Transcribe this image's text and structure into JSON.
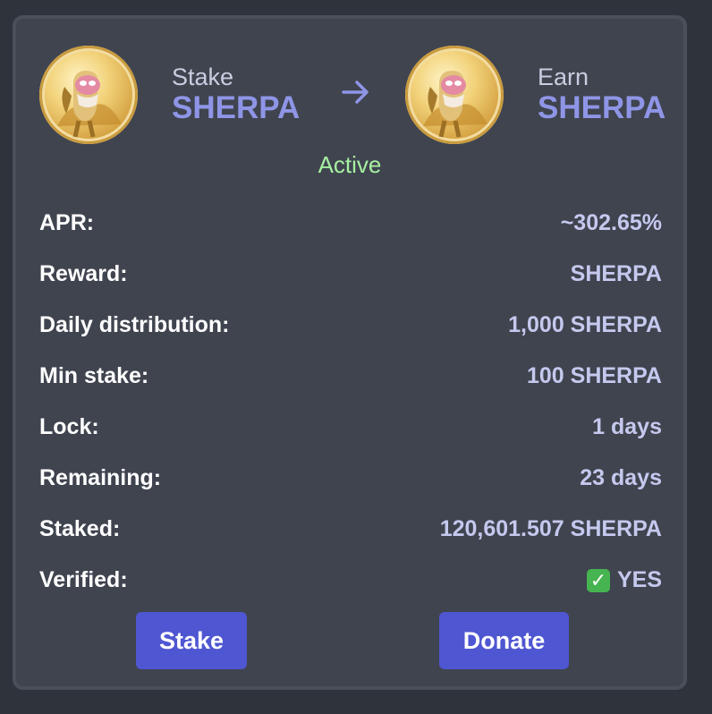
{
  "stake": {
    "verb": "Stake",
    "symbol": "SHERPA"
  },
  "earn": {
    "verb": "Earn",
    "symbol": "SHERPA"
  },
  "status": "Active",
  "rows": [
    {
      "label": "APR:",
      "value": "~302.65%"
    },
    {
      "label": "Reward:",
      "value": "SHERPA"
    },
    {
      "label": "Daily distribution:",
      "value": "1,000 SHERPA"
    },
    {
      "label": "Min stake:",
      "value": "100 SHERPA"
    },
    {
      "label": "Lock:",
      "value": "1 days"
    },
    {
      "label": "Remaining:",
      "value": "23 days"
    },
    {
      "label": "Staked:",
      "value": "120,601.507 SHERPA"
    },
    {
      "label": "Verified:",
      "value": "YES",
      "icon": "check-mark-icon"
    }
  ],
  "buttons": {
    "stake": "Stake",
    "donate": "Donate"
  },
  "colors": {
    "background": "#2f333c",
    "card": "#3f444f",
    "accent": "#8f95e6",
    "status": "#a6f0a0",
    "button": "#4f56d2"
  }
}
